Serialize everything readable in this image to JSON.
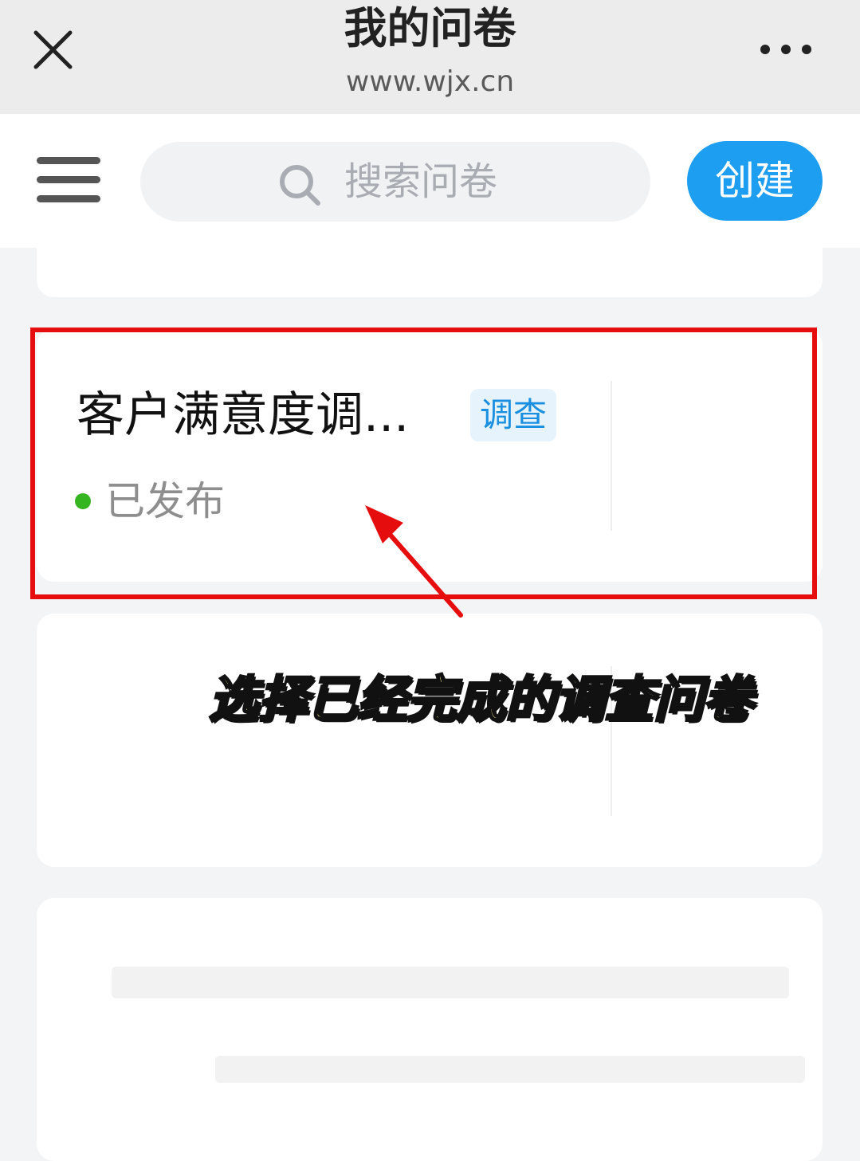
{
  "header": {
    "title": "我的问卷",
    "url": "www.wjx.cn"
  },
  "toolbar": {
    "search_placeholder": "搜索问卷",
    "create_label": "创建"
  },
  "survey": {
    "title": "客户满意度调...",
    "type_tag": "调查",
    "status": "已发布",
    "status_color": "#35b51f"
  },
  "annotation": {
    "caption": "选择已经完成的调查问卷",
    "highlight_color": "#e50d0d"
  },
  "colors": {
    "accent": "#1e9ef0"
  }
}
